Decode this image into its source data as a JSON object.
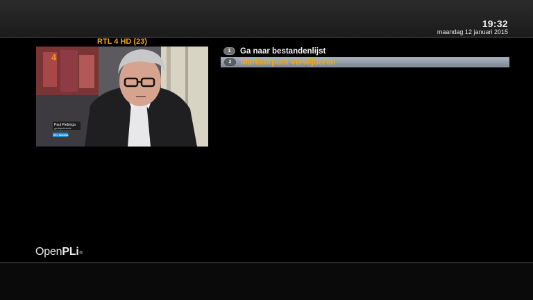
{
  "header": {
    "time": "19:32",
    "date": "maandag 12 januari 2015"
  },
  "preview": {
    "channel": "RTL 4 HD (23)",
    "station_logo": "4",
    "lower_third_name": "Paul Piebinga",
    "lower_third_role": "gedeputeerde",
    "lower_third_tag": "RTL NIEUWS"
  },
  "menu": {
    "items": [
      {
        "number": "1",
        "label": "Ga naar bestandenlijst",
        "selected": false
      },
      {
        "number": "2",
        "label": "Markeerpunt verwijderen",
        "selected": true
      }
    ]
  },
  "footer": {
    "logo_light": "Open",
    "logo_bold": "PLi",
    "logo_mark": "®"
  },
  "colors": {
    "accent": "#f2a61c",
    "selection": "#8f9aa6"
  }
}
